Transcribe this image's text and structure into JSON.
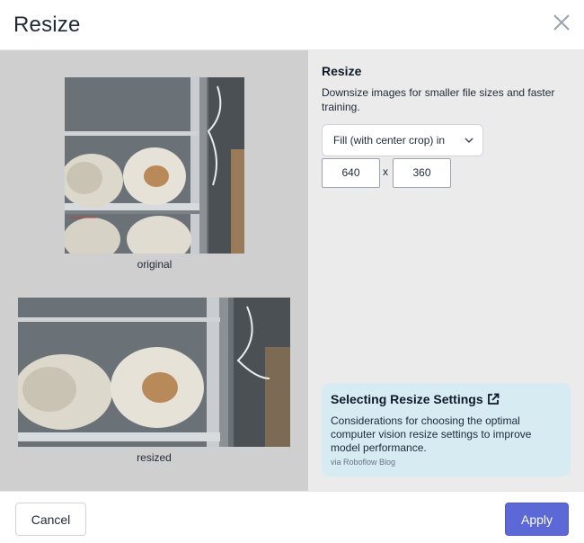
{
  "dialog": {
    "title": "Resize",
    "close_icon": "close-icon"
  },
  "preview": {
    "original_caption": "original",
    "resized_caption": "resized",
    "image_subject": "mushroom grow bags on metal shelving"
  },
  "settings": {
    "title": "Resize",
    "description": "Downsize images for smaller file sizes and faster training.",
    "mode_selected": "Fill (with center crop) in",
    "width": "640",
    "height": "360",
    "separator": "x"
  },
  "info_card": {
    "title": "Selecting Resize Settings",
    "icon": "external-link-icon",
    "description": "Considerations for choosing the optimal computer vision resize settings to improve model performance.",
    "source": "via Roboflow Blog"
  },
  "footer": {
    "cancel_label": "Cancel",
    "apply_label": "Apply"
  },
  "colors": {
    "apply_bg": "#5b68d6",
    "card_bg": "#d6ecf2",
    "preview_bg": "#cfcfcf",
    "settings_bg": "#ebebeb"
  }
}
